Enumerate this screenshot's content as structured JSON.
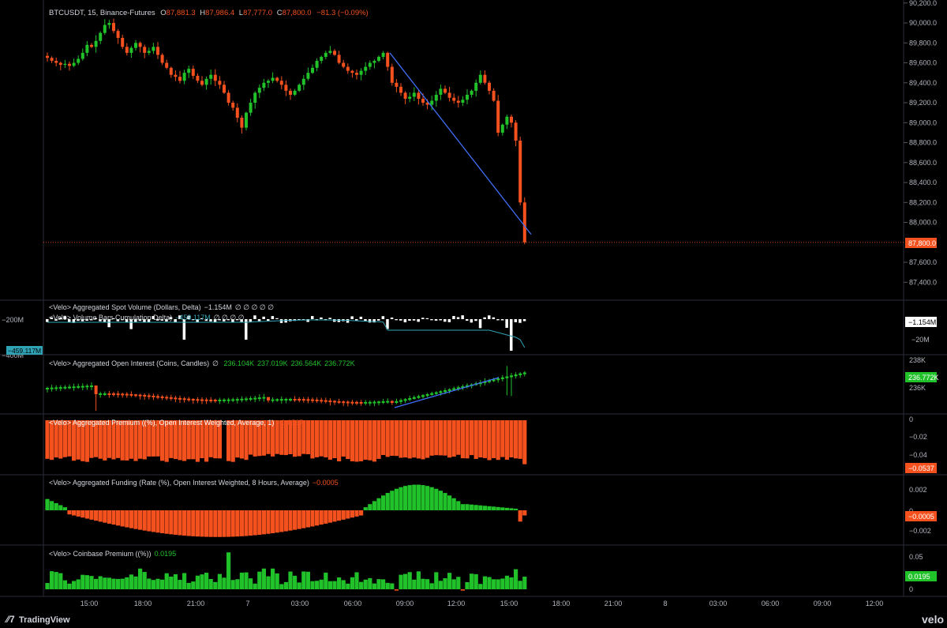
{
  "colors": {
    "bg": "#000000",
    "up": "#21c12a",
    "down": "#f4511e",
    "grid": "#2a2e39",
    "text": "#d1d4dc",
    "axisText": "#b2b5be",
    "trend": "#3f6ef5",
    "lastLine": "#f4511e",
    "volLine": "#2fa3b5",
    "white": "#ffffff"
  },
  "price_pane": {
    "header": {
      "symbol": "BTCUSDT, 15, Binance-Futures",
      "o_label": "O",
      "o": "87,881.3",
      "h_label": "H",
      "h": "87,986.4",
      "l_label": "L",
      "l": "87,777.0",
      "c_label": "C",
      "c": "87,800.0",
      "change": "−81.3 (−0.09%)"
    },
    "last_price_badge": "87,800.0"
  },
  "spot_pane": {
    "title": "<Velo> Aggregated Spot Volume (Dollars, Delta)",
    "title_value": "−1.154M",
    "title_dots": "∅ ∅ ∅ ∅ ∅",
    "title2": "<Velo> Volume Bars Cumulation Delta)",
    "title2_value": "−459.117M",
    "title2_dots": "∅ ∅ ∅ ∅",
    "badge_right": "−1.154M",
    "badge_left": "−459.117M"
  },
  "oi_pane": {
    "title": "<Velo> Aggregated Open Interest (Coins, Candles)",
    "dot": "∅",
    "v1": "236.104K",
    "v2": "237.019K",
    "v3": "236.564K",
    "v4": "236.772K",
    "badge": "236.772K"
  },
  "premium_pane": {
    "title": "<Velo> Aggregated Premium ((%), Open Interest Weighted, Average, 1)",
    "value": "−0.0537",
    "badge": "−0.0537"
  },
  "funding_pane": {
    "title": "<Velo> Aggregated Funding (Rate (%), Open Interest Weighted, 8 Hours, Average)",
    "value": "−0.0005",
    "badge": "−0.0005"
  },
  "coinbase_pane": {
    "title": "<Velo> Coinbase Premium ((%))",
    "value": "0.0195",
    "badge": "0.0195"
  },
  "footer": {
    "logo_text": "TradingView",
    "brand": "velo"
  },
  "chart_data": [
    {
      "type": "candlestick",
      "title": "BTCUSDT, 15, Binance-Futures",
      "x_ticks": [
        "15:00",
        "18:00",
        "21:00",
        "7",
        "03:00",
        "06:00",
        "09:00",
        "12:00",
        "15:00",
        "18:00",
        "21:00",
        "8",
        "03:00",
        "06:00",
        "09:00",
        "12:00"
      ],
      "y_ticks": [
        "90,200.0",
        "90,000.0",
        "89,800.0",
        "89,600.0",
        "89,400.0",
        "89,200.0",
        "89,000.0",
        "88,800.0",
        "88,600.0",
        "88,400.0",
        "88,200.0",
        "88,000.0",
        "87,600.0",
        "87,400.0"
      ],
      "ylim": [
        87260,
        90230
      ],
      "last_price": 87800,
      "close": [
        89650,
        89620,
        89600,
        89580,
        89590,
        89570,
        89600,
        89640,
        89700,
        89780,
        89760,
        89820,
        89900,
        89980,
        90000,
        89920,
        89850,
        89760,
        89700,
        89750,
        89800,
        89760,
        89700,
        89720,
        89760,
        89680,
        89600,
        89550,
        89480,
        89460,
        89420,
        89500,
        89540,
        89470,
        89420,
        89380,
        89440,
        89480,
        89420,
        89380,
        89300,
        89200,
        89150,
        89050,
        88950,
        89100,
        89200,
        89300,
        89350,
        89400,
        89420,
        89450,
        89420,
        89380,
        89320,
        89280,
        89320,
        89380,
        89440,
        89500,
        89550,
        89620,
        89660,
        89700,
        89720,
        89680,
        89600,
        89560,
        89520,
        89500,
        89480,
        89520,
        89560,
        89600,
        89620,
        89660,
        89700,
        89560,
        89400,
        89360,
        89300,
        89240,
        89260,
        89300,
        89240,
        89200,
        89180,
        89220,
        89280,
        89340,
        89300,
        89250,
        89220,
        89200,
        89230,
        89280,
        89320,
        89400,
        89480,
        89400,
        89320,
        89220,
        88900,
        88980,
        89060,
        89000,
        88820,
        88200,
        87800
      ],
      "trendline_start": [
        89700,
        "at ~08:45"
      ],
      "trendline_end": [
        87880,
        "at ~15:30"
      ]
    },
    {
      "type": "bar",
      "title": "<Velo> Aggregated Spot Volume (Dollars, Delta)",
      "y_ticks": [
        "−200M",
        "−400M",
        "−20M"
      ],
      "last": -1.154,
      "cumulative_last": -459.117,
      "unit": "M"
    },
    {
      "type": "candlestick",
      "title": "<Velo> Aggregated Open Interest (Coins, Candles)",
      "y_ticks": [
        "238K",
        "236K"
      ],
      "last": 236772
    },
    {
      "type": "bar",
      "title": "<Velo> Aggregated Premium ((%), Open Interest Weighted, Average, 1)",
      "y_ticks": [
        "0",
        "−0.02",
        "−0.04"
      ],
      "ylim": [
        -0.055,
        0.0
      ],
      "last": -0.0537
    },
    {
      "type": "bar",
      "title": "<Velo> Aggregated Funding (Rate (%), Open Interest Weighted, 8 Hours, Average)",
      "y_ticks": [
        "0.002",
        "0",
        "−0.002"
      ],
      "ylim": [
        -0.0025,
        0.0032
      ],
      "last": -0.0005
    },
    {
      "type": "bar",
      "title": "<Velo> Coinbase Premium ((%))",
      "y_ticks": [
        "0.05",
        "0"
      ],
      "ylim": [
        -0.003,
        0.058
      ],
      "last": 0.0195
    }
  ]
}
